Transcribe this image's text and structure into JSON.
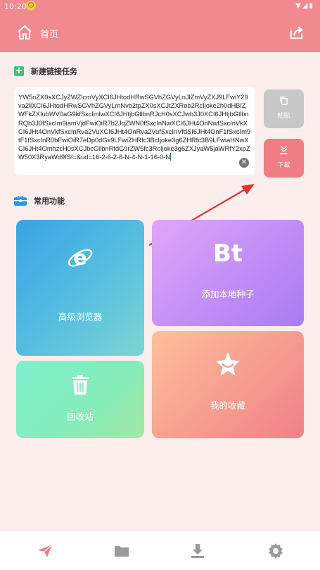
{
  "status_bar": {
    "time": "10:20"
  },
  "app_bar": {
    "title": "首页"
  },
  "new_task": {
    "section_title": "新建链接任务",
    "link_text": "YW5nZX0sXCJyZWZlcmVyXCI6JHtodHRwSGVhZGVyLnJlZmVyZXJ9LFwiY29va2llXCI6JHtodHRwSGVhZGVyLmNvb2tpZX0sXCJtZXRob2RcIjoke2h0dHBIZWFkZXIubWV0aG9kfSxcImlwXCI6JHtjbGllbnRJcH0sXCJwb3J0XCI6JHtjbGllbnRQb3J0fSxcIm9iamVjdFwiOiR7b2JqZWN0fSxcInNwXCI6JHt4OnNwfSxcInVkXCI6JHt4OnVkfSxcInRva2VuXCI6JHt4OnRva2VufSxcInVfdSI6JHt4OnF1fSxcIm9tF1fSxcInR0bFwiOiR7eDp0dGx9LFwiZHRfc3BcIjoke3g6ZHRfc3B9LFwiaHNwXCI6JHt4OmhzcH0sXCJbcGllbnRfdG9rZW5fc3RcIjoke3g6ZXJyaW5jaWRfY2xpZW50X3RyaWd9fSI=&ud=16-2-6-2-8-N-4-N-1-16-0-N",
    "paste_label": "粘贴",
    "download_label": "下载"
  },
  "features": {
    "section_title": "常用功能",
    "browser_label": "高级浏览器",
    "torrent_icon_text": "Bt",
    "torrent_label": "添加本地种子",
    "recycle_label": "回收站",
    "favorites_label": "我的收藏"
  },
  "colors": {
    "accent": "#f08a8f",
    "background": "#fdeeee",
    "plus_green": "#3ec47b",
    "bag_blue": "#1e9be9",
    "nav_active": "#f07d83",
    "nav_inactive": "#9a9a9a"
  },
  "icons": {
    "home": "home-icon",
    "share": "share-icon",
    "paste": "copy-icon",
    "download": "download-icon",
    "browser": "ie-browser-icon",
    "recycle": "trash-icon",
    "favorites": "star-icon",
    "nav": [
      "send-icon",
      "folder-icon",
      "download-icon",
      "gear-icon"
    ]
  }
}
